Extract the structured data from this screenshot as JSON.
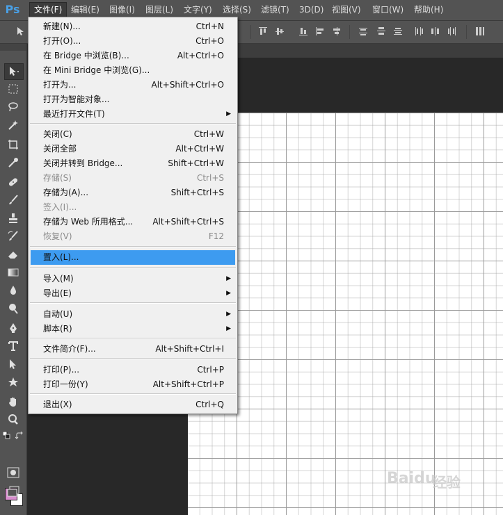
{
  "app": {
    "logo": "Ps"
  },
  "menubar": {
    "items": [
      {
        "label": "文件(F)",
        "active": true
      },
      {
        "label": "编辑(E)"
      },
      {
        "label": "图像(I)"
      },
      {
        "label": "图层(L)"
      },
      {
        "label": "文字(Y)"
      },
      {
        "label": "选择(S)"
      },
      {
        "label": "滤镜(T)"
      },
      {
        "label": "3D(D)"
      },
      {
        "label": "视图(V)"
      },
      {
        "label": "窗口(W)"
      },
      {
        "label": "帮助(H)"
      }
    ]
  },
  "file_menu": {
    "items": [
      {
        "label": "新建(N)...",
        "shortcut": "Ctrl+N"
      },
      {
        "label": "打开(O)...",
        "shortcut": "Ctrl+O"
      },
      {
        "label": "在 Bridge 中浏览(B)...",
        "shortcut": "Alt+Ctrl+O"
      },
      {
        "label": "在 Mini Bridge 中浏览(G)...",
        "shortcut": ""
      },
      {
        "label": "打开为...",
        "shortcut": "Alt+Shift+Ctrl+O"
      },
      {
        "label": "打开为智能对象...",
        "shortcut": ""
      },
      {
        "label": "最近打开文件(T)",
        "shortcut": "",
        "submenu": true
      },
      {
        "label": "关闭(C)",
        "shortcut": "Ctrl+W"
      },
      {
        "label": "关闭全部",
        "shortcut": "Alt+Ctrl+W"
      },
      {
        "label": "关闭并转到 Bridge...",
        "shortcut": "Shift+Ctrl+W"
      },
      {
        "label": "存储(S)",
        "shortcut": "Ctrl+S",
        "disabled": true
      },
      {
        "label": "存储为(A)...",
        "shortcut": "Shift+Ctrl+S"
      },
      {
        "label": "签入(I)...",
        "shortcut": "",
        "disabled": true
      },
      {
        "label": "存储为 Web 所用格式...",
        "shortcut": "Alt+Shift+Ctrl+S"
      },
      {
        "label": "恢复(V)",
        "shortcut": "F12",
        "disabled": true
      },
      {
        "label": "置入(L)...",
        "shortcut": "",
        "highlighted": true
      },
      {
        "label": "导入(M)",
        "shortcut": "",
        "submenu": true
      },
      {
        "label": "导出(E)",
        "shortcut": "",
        "submenu": true
      },
      {
        "label": "自动(U)",
        "shortcut": "",
        "submenu": true
      },
      {
        "label": "脚本(R)",
        "shortcut": "",
        "submenu": true
      },
      {
        "label": "文件简介(F)...",
        "shortcut": "Alt+Shift+Ctrl+I"
      },
      {
        "label": "打印(P)...",
        "shortcut": "Ctrl+P"
      },
      {
        "label": "打印一份(Y)",
        "shortcut": "Alt+Shift+Ctrl+P"
      },
      {
        "label": "退出(X)",
        "shortcut": "Ctrl+Q"
      }
    ],
    "submenu_arrow": "▶"
  },
  "tools": [
    "move-icon",
    "marquee-icon",
    "lasso-icon",
    "magic-wand-icon",
    "crop-icon",
    "eyedropper-icon",
    "healing-brush-icon",
    "brush-icon",
    "clone-stamp-icon",
    "history-brush-icon",
    "eraser-icon",
    "gradient-icon",
    "blur-icon",
    "dodge-icon",
    "pen-icon",
    "type-icon",
    "path-select-icon",
    "shape-icon",
    "hand-icon",
    "zoom-icon"
  ],
  "colors": {
    "foreground": "#d98fcf",
    "background": "#ffffff",
    "highlight": "#3d9bf0"
  },
  "watermark": {
    "brand": "Bai",
    "paw": "du",
    "sub": "经验"
  }
}
